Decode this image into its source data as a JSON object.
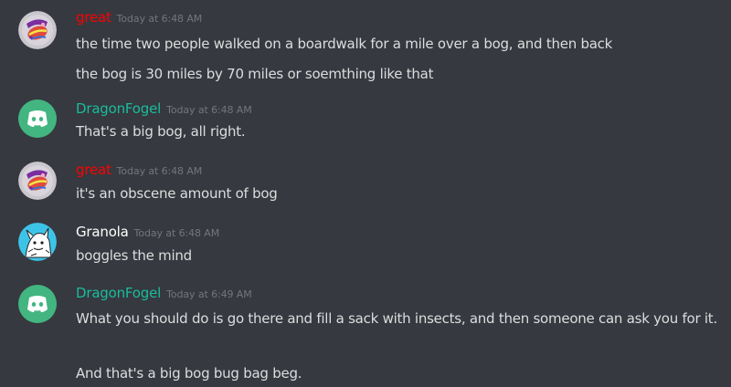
{
  "colors": {
    "background": "#36393f",
    "message_text": "#dcddde",
    "timestamp": "#72767d",
    "red_role": "#ff0000",
    "teal_role": "#1abc9c",
    "default_name": "#ffffff",
    "discord_avatar_bg": "#43b581"
  },
  "messages": [
    {
      "author": "great",
      "avatar_icon": "candy-avatar-icon",
      "timestamp": "Today at 6:48 AM",
      "lines": [
        "the time two people walked on a boardwalk for a mile over a bog, and then back",
        "the bog is 30 miles by 70 miles or soemthing like that"
      ]
    },
    {
      "author": "DragonFogel",
      "avatar_icon": "discord-logo-icon",
      "timestamp": "Today at 6:48 AM",
      "lines": [
        "That's a big bog, all right."
      ]
    },
    {
      "author": "great",
      "avatar_icon": "candy-avatar-icon",
      "timestamp": "Today at 6:48 AM",
      "lines": [
        "it's an obscene amount of bog"
      ]
    },
    {
      "author": "Granola",
      "avatar_icon": "sketch-character-avatar-icon",
      "timestamp": "Today at 6:48 AM",
      "lines": [
        "boggles the mind"
      ]
    },
    {
      "author": "DragonFogel",
      "avatar_icon": "discord-logo-icon",
      "timestamp": "Today at 6:49 AM",
      "lines": [
        "What you should do is go there and fill a sack with insects, and then someone can ask you for it.",
        "And that's a big bog bug bag beg."
      ]
    }
  ]
}
